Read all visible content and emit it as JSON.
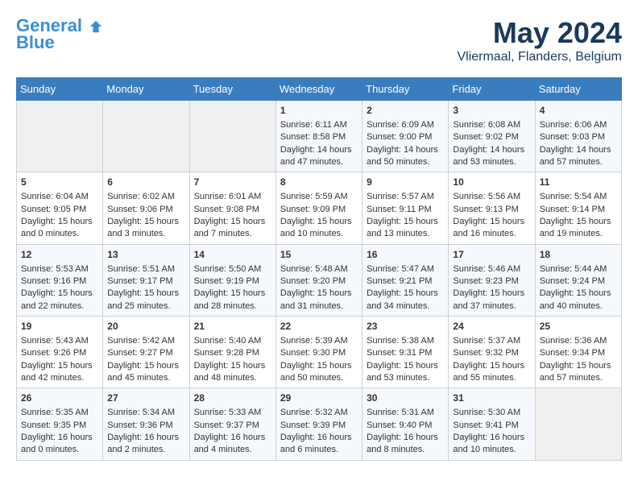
{
  "header": {
    "logo_line1": "General",
    "logo_line2": "Blue",
    "month": "May 2024",
    "location": "Vliermaal, Flanders, Belgium"
  },
  "days_of_week": [
    "Sunday",
    "Monday",
    "Tuesday",
    "Wednesday",
    "Thursday",
    "Friday",
    "Saturday"
  ],
  "weeks": [
    [
      {
        "day": "",
        "data": []
      },
      {
        "day": "",
        "data": []
      },
      {
        "day": "",
        "data": []
      },
      {
        "day": "1",
        "data": [
          "Sunrise: 6:11 AM",
          "Sunset: 8:58 PM",
          "Daylight: 14 hours",
          "and 47 minutes."
        ]
      },
      {
        "day": "2",
        "data": [
          "Sunrise: 6:09 AM",
          "Sunset: 9:00 PM",
          "Daylight: 14 hours",
          "and 50 minutes."
        ]
      },
      {
        "day": "3",
        "data": [
          "Sunrise: 6:08 AM",
          "Sunset: 9:02 PM",
          "Daylight: 14 hours",
          "and 53 minutes."
        ]
      },
      {
        "day": "4",
        "data": [
          "Sunrise: 6:06 AM",
          "Sunset: 9:03 PM",
          "Daylight: 14 hours",
          "and 57 minutes."
        ]
      }
    ],
    [
      {
        "day": "5",
        "data": [
          "Sunrise: 6:04 AM",
          "Sunset: 9:05 PM",
          "Daylight: 15 hours",
          "and 0 minutes."
        ]
      },
      {
        "day": "6",
        "data": [
          "Sunrise: 6:02 AM",
          "Sunset: 9:06 PM",
          "Daylight: 15 hours",
          "and 3 minutes."
        ]
      },
      {
        "day": "7",
        "data": [
          "Sunrise: 6:01 AM",
          "Sunset: 9:08 PM",
          "Daylight: 15 hours",
          "and 7 minutes."
        ]
      },
      {
        "day": "8",
        "data": [
          "Sunrise: 5:59 AM",
          "Sunset: 9:09 PM",
          "Daylight: 15 hours",
          "and 10 minutes."
        ]
      },
      {
        "day": "9",
        "data": [
          "Sunrise: 5:57 AM",
          "Sunset: 9:11 PM",
          "Daylight: 15 hours",
          "and 13 minutes."
        ]
      },
      {
        "day": "10",
        "data": [
          "Sunrise: 5:56 AM",
          "Sunset: 9:13 PM",
          "Daylight: 15 hours",
          "and 16 minutes."
        ]
      },
      {
        "day": "11",
        "data": [
          "Sunrise: 5:54 AM",
          "Sunset: 9:14 PM",
          "Daylight: 15 hours",
          "and 19 minutes."
        ]
      }
    ],
    [
      {
        "day": "12",
        "data": [
          "Sunrise: 5:53 AM",
          "Sunset: 9:16 PM",
          "Daylight: 15 hours",
          "and 22 minutes."
        ]
      },
      {
        "day": "13",
        "data": [
          "Sunrise: 5:51 AM",
          "Sunset: 9:17 PM",
          "Daylight: 15 hours",
          "and 25 minutes."
        ]
      },
      {
        "day": "14",
        "data": [
          "Sunrise: 5:50 AM",
          "Sunset: 9:19 PM",
          "Daylight: 15 hours",
          "and 28 minutes."
        ]
      },
      {
        "day": "15",
        "data": [
          "Sunrise: 5:48 AM",
          "Sunset: 9:20 PM",
          "Daylight: 15 hours",
          "and 31 minutes."
        ]
      },
      {
        "day": "16",
        "data": [
          "Sunrise: 5:47 AM",
          "Sunset: 9:21 PM",
          "Daylight: 15 hours",
          "and 34 minutes."
        ]
      },
      {
        "day": "17",
        "data": [
          "Sunrise: 5:46 AM",
          "Sunset: 9:23 PM",
          "Daylight: 15 hours",
          "and 37 minutes."
        ]
      },
      {
        "day": "18",
        "data": [
          "Sunrise: 5:44 AM",
          "Sunset: 9:24 PM",
          "Daylight: 15 hours",
          "and 40 minutes."
        ]
      }
    ],
    [
      {
        "day": "19",
        "data": [
          "Sunrise: 5:43 AM",
          "Sunset: 9:26 PM",
          "Daylight: 15 hours",
          "and 42 minutes."
        ]
      },
      {
        "day": "20",
        "data": [
          "Sunrise: 5:42 AM",
          "Sunset: 9:27 PM",
          "Daylight: 15 hours",
          "and 45 minutes."
        ]
      },
      {
        "day": "21",
        "data": [
          "Sunrise: 5:40 AM",
          "Sunset: 9:28 PM",
          "Daylight: 15 hours",
          "and 48 minutes."
        ]
      },
      {
        "day": "22",
        "data": [
          "Sunrise: 5:39 AM",
          "Sunset: 9:30 PM",
          "Daylight: 15 hours",
          "and 50 minutes."
        ]
      },
      {
        "day": "23",
        "data": [
          "Sunrise: 5:38 AM",
          "Sunset: 9:31 PM",
          "Daylight: 15 hours",
          "and 53 minutes."
        ]
      },
      {
        "day": "24",
        "data": [
          "Sunrise: 5:37 AM",
          "Sunset: 9:32 PM",
          "Daylight: 15 hours",
          "and 55 minutes."
        ]
      },
      {
        "day": "25",
        "data": [
          "Sunrise: 5:36 AM",
          "Sunset: 9:34 PM",
          "Daylight: 15 hours",
          "and 57 minutes."
        ]
      }
    ],
    [
      {
        "day": "26",
        "data": [
          "Sunrise: 5:35 AM",
          "Sunset: 9:35 PM",
          "Daylight: 16 hours",
          "and 0 minutes."
        ]
      },
      {
        "day": "27",
        "data": [
          "Sunrise: 5:34 AM",
          "Sunset: 9:36 PM",
          "Daylight: 16 hours",
          "and 2 minutes."
        ]
      },
      {
        "day": "28",
        "data": [
          "Sunrise: 5:33 AM",
          "Sunset: 9:37 PM",
          "Daylight: 16 hours",
          "and 4 minutes."
        ]
      },
      {
        "day": "29",
        "data": [
          "Sunrise: 5:32 AM",
          "Sunset: 9:39 PM",
          "Daylight: 16 hours",
          "and 6 minutes."
        ]
      },
      {
        "day": "30",
        "data": [
          "Sunrise: 5:31 AM",
          "Sunset: 9:40 PM",
          "Daylight: 16 hours",
          "and 8 minutes."
        ]
      },
      {
        "day": "31",
        "data": [
          "Sunrise: 5:30 AM",
          "Sunset: 9:41 PM",
          "Daylight: 16 hours",
          "and 10 minutes."
        ]
      },
      {
        "day": "",
        "data": []
      }
    ]
  ]
}
